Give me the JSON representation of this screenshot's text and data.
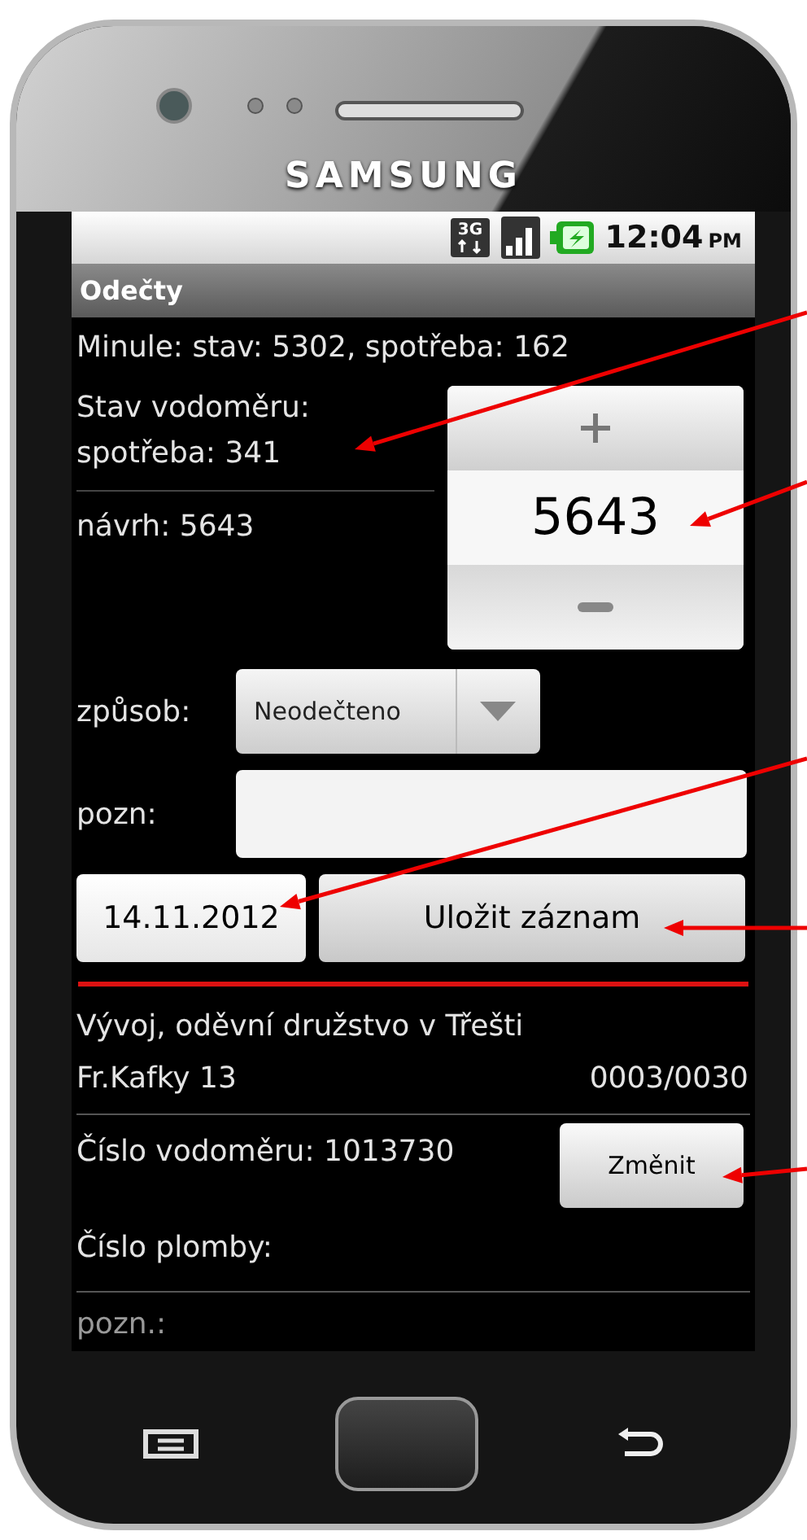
{
  "device": {
    "brand": "SAMSUNG"
  },
  "status_bar": {
    "network": "3G",
    "time": "12:04",
    "meridiem": "PM"
  },
  "title_bar": {
    "title": "Odečty"
  },
  "previous": "Minule: stav: 5302, spotřeba: 162",
  "meter_reading": {
    "label": "Stav vodoměru:",
    "consumption": "spotřeba: 341",
    "suggestion": "návrh: 5643"
  },
  "number_picker": {
    "value": "5643"
  },
  "method": {
    "label": "způsob:",
    "value": "Neodečteno"
  },
  "note": {
    "label": "pozn:"
  },
  "date_button": "14.11.2012",
  "save_button": "Uložit záznam",
  "customer": {
    "name": "Vývoj, oděvní družstvo v Třešti",
    "street": "Fr.Kafky 13",
    "code": "0003/0030"
  },
  "meter_number": {
    "text": "Číslo vodoměru: 1013730",
    "button": "Změnit"
  },
  "seal_number": "Číslo plomby:",
  "note_cut": "pozn.:",
  "annotations": [
    {
      "kind": "arrow"
    },
    {
      "kind": "arrow"
    },
    {
      "kind": "arrow"
    },
    {
      "kind": "arrow"
    },
    {
      "kind": "arrow"
    }
  ]
}
